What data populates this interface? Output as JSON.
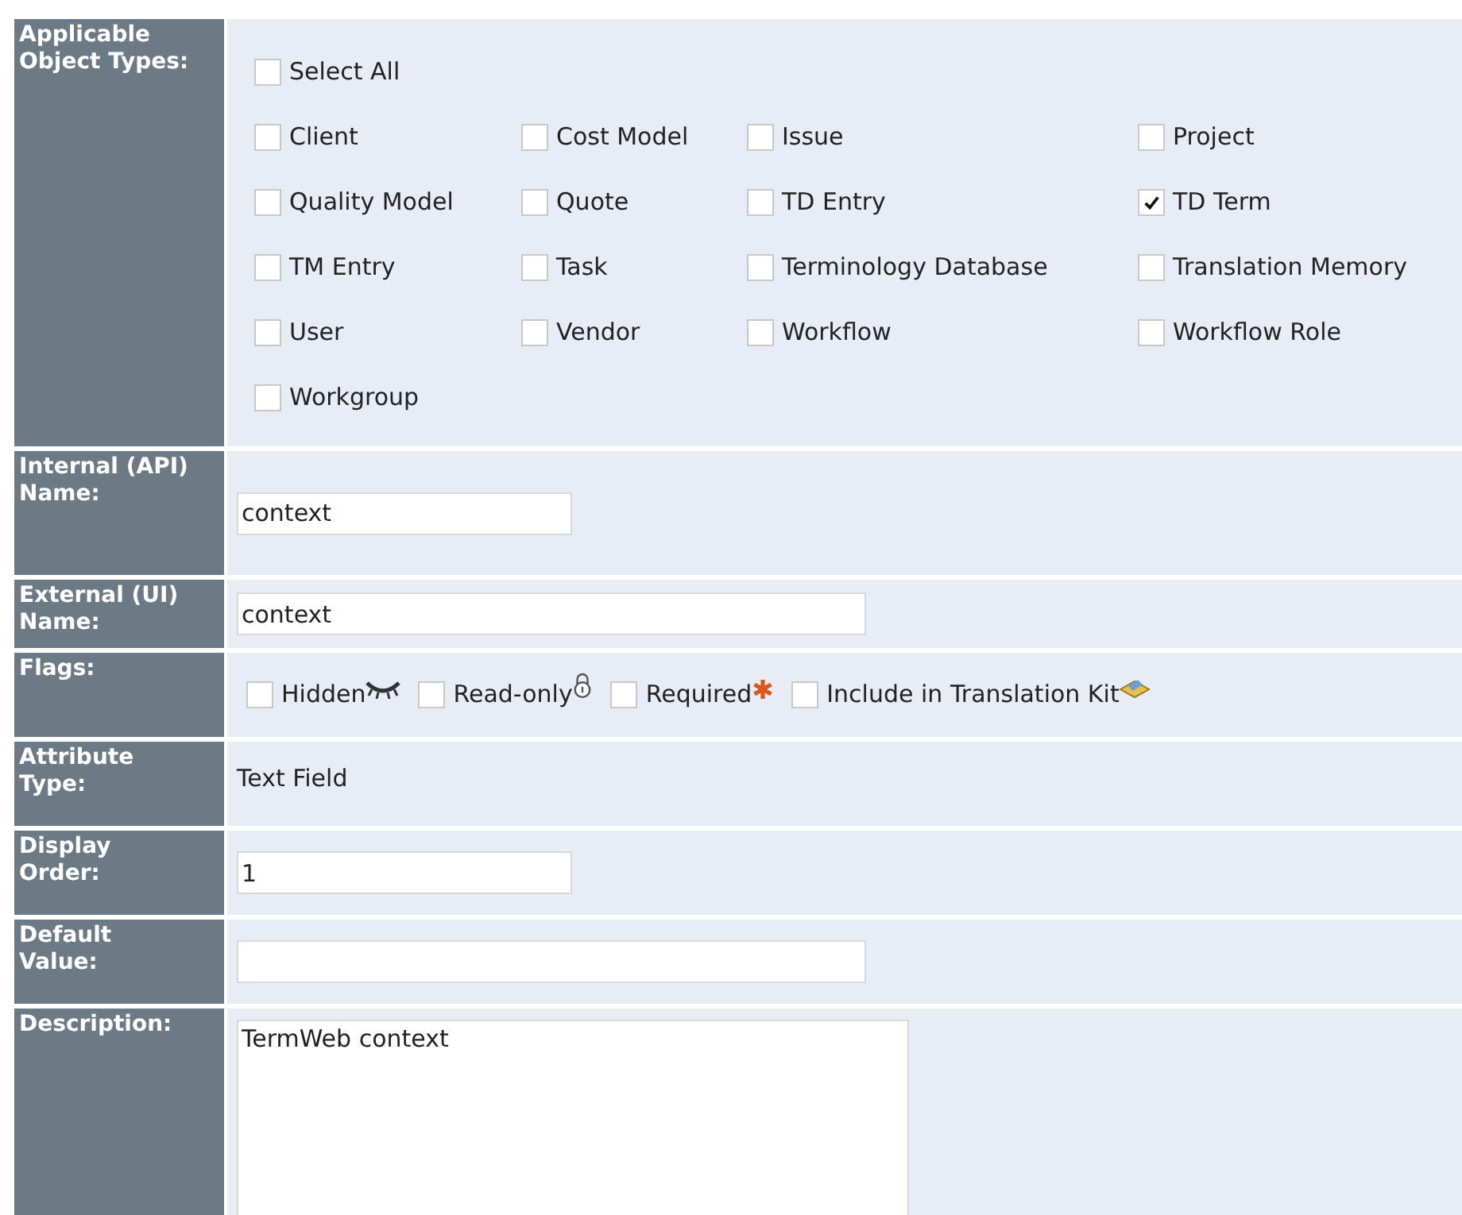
{
  "rows": [
    {
      "kind": "checkboxes",
      "label": "Applicable Object Types:",
      "select_all": {
        "label": "Select All",
        "checked": false
      },
      "items": [
        {
          "label": "Client",
          "checked": false
        },
        {
          "label": "Cost Model",
          "checked": false
        },
        {
          "label": "Issue",
          "checked": false
        },
        {
          "label": "Project",
          "checked": false
        },
        {
          "label": "Quality Model",
          "checked": false
        },
        {
          "label": "Quote",
          "checked": false
        },
        {
          "label": "TD Entry",
          "checked": false
        },
        {
          "label": "TD Term",
          "checked": true
        },
        {
          "label": "TM Entry",
          "checked": false
        },
        {
          "label": "Task",
          "checked": false
        },
        {
          "label": "Terminology Database",
          "checked": false
        },
        {
          "label": "Translation Memory",
          "checked": false
        },
        {
          "label": "User",
          "checked": false
        },
        {
          "label": "Vendor",
          "checked": false
        },
        {
          "label": "Workflow",
          "checked": false
        },
        {
          "label": "Workflow Role",
          "checked": false
        },
        {
          "label": "Workgroup",
          "checked": false
        }
      ]
    },
    {
      "kind": "input",
      "label": "Internal (API) Name:",
      "value": "context"
    },
    {
      "kind": "input",
      "label": "External (UI) Name:",
      "value": "context"
    },
    {
      "kind": "flags",
      "label": "Flags:",
      "flags": [
        {
          "label": "Hidden",
          "checked": false
        },
        {
          "label": "Read-only",
          "checked": false
        },
        {
          "label": "Required",
          "checked": false
        },
        {
          "label": "Include in Translation Kit",
          "checked": false
        }
      ]
    },
    {
      "kind": "text",
      "label": "Attribute Type:",
      "value": "Text Field"
    },
    {
      "kind": "input",
      "label": "Display Order:",
      "value": "1"
    },
    {
      "kind": "input",
      "label": "Default Value:",
      "value": ""
    },
    {
      "kind": "textarea",
      "label": "Description:",
      "value": "TermWeb context"
    }
  ]
}
